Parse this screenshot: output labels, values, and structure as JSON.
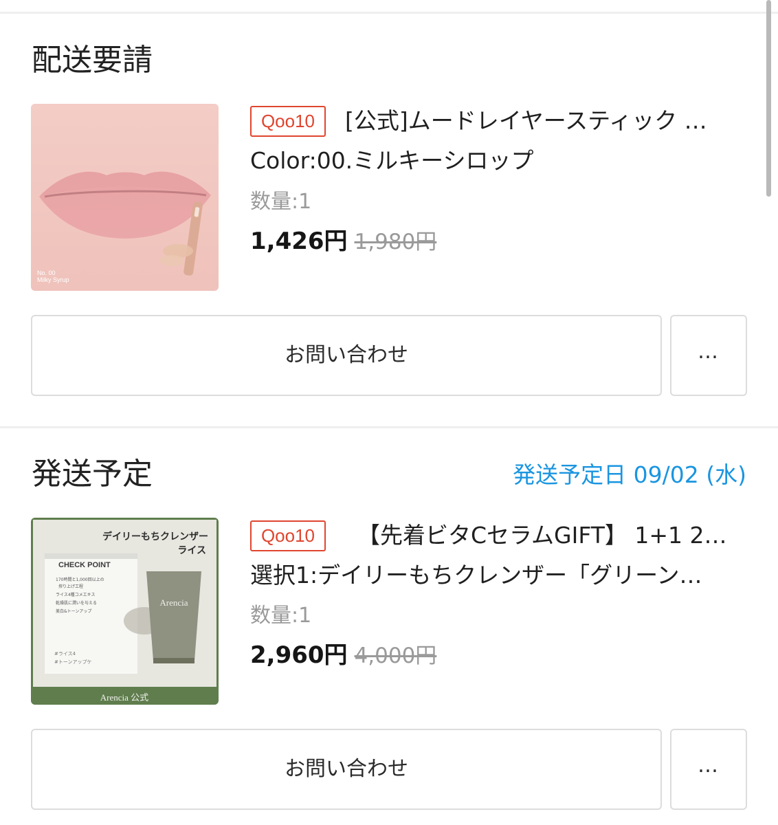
{
  "sections": [
    {
      "title": "配送要請",
      "ship_date": "",
      "item": {
        "shop_badge": "Qoo10",
        "title": "[公式]ムードレイヤースティック …",
        "option": "Color:00.ミルキーシロップ",
        "quantity": "数量:1",
        "price": "1,426円",
        "original_price": "1,980円",
        "thumbnail_caption_1": "No. 00",
        "thumbnail_caption_2": "Milky Syrup"
      },
      "inquiry_label": "お問い合わせ",
      "more_label": "…"
    },
    {
      "title": "発送予定",
      "ship_date": "発送予定日 09/02 (水)",
      "item": {
        "shop_badge": "Qoo10",
        "title": "【先着ビタCセラムGIFT】 1+1 2個…",
        "option": "選択1:デイリーもちクレンザー「グリーン…",
        "quantity": "数量:1",
        "price": "2,960円",
        "original_price": "4,000円",
        "thumbnail_heading_1": "デイリーもちクレンザー",
        "thumbnail_heading_2": "ライス",
        "thumbnail_check": "CHECK POINT",
        "thumbnail_points": [
          "170時間と1,000回以上の",
          "搾り上げ工程",
          "ライス4種コメエキス",
          "乾燥肌に潤いを与える",
          "美白&トーンアップ"
        ],
        "thumbnail_tags": [
          "#ライス4",
          "#トーンアップケ"
        ],
        "thumbnail_brand": "Arencia 公式",
        "thumbnail_tube_brand": "Arencia"
      },
      "inquiry_label": "お問い合わせ",
      "more_label": "…"
    }
  ],
  "colors": {
    "accent_blue": "#1a95e0",
    "badge_red": "#e0452e",
    "muted_gray": "#9a9a9a",
    "divider": "#efefef"
  }
}
